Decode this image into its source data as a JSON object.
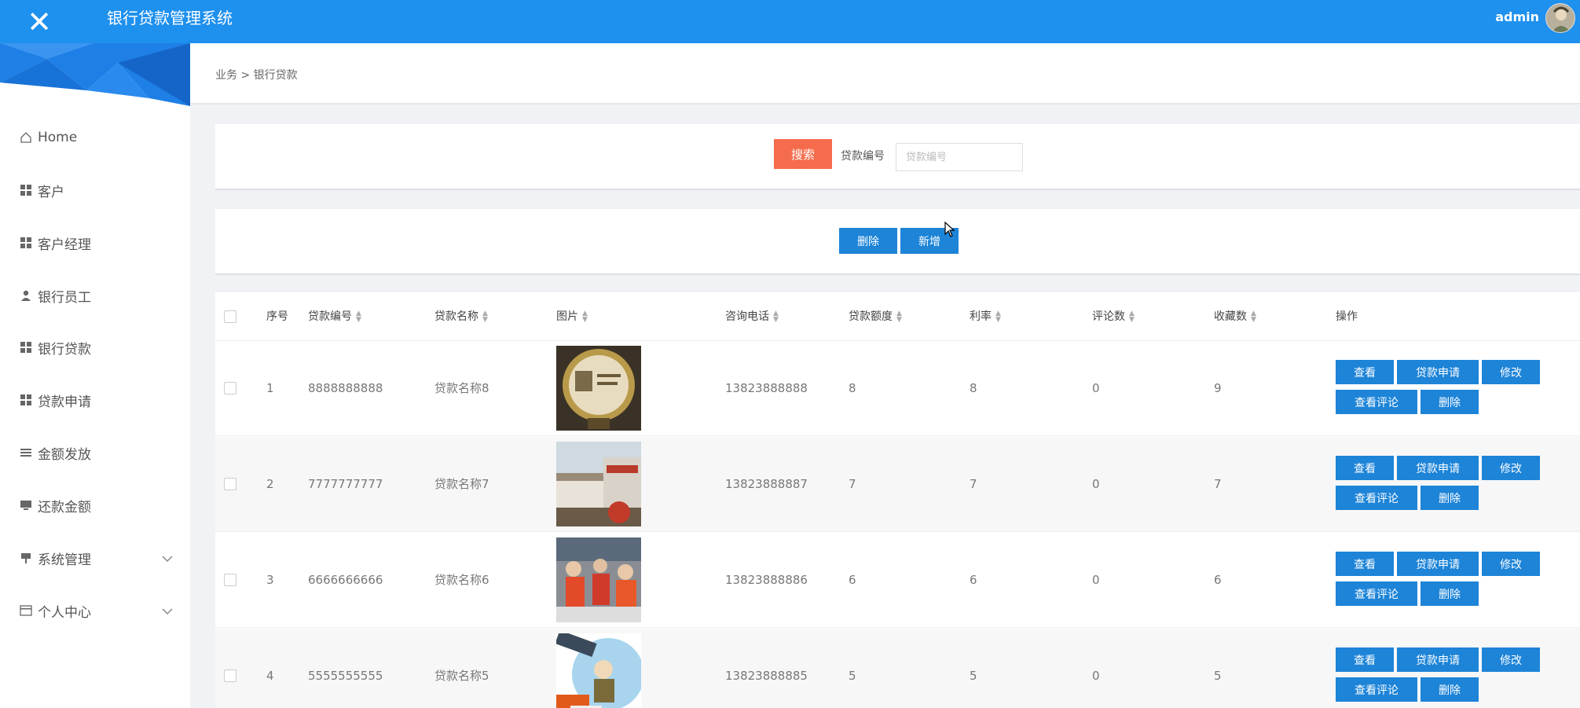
{
  "header": {
    "title": "银行贷款管理系统",
    "user": "admin",
    "colors": {
      "primary": "#1e90ee",
      "danger": "#f56c4c",
      "button": "#1d84d8"
    }
  },
  "sidebar": {
    "items": [
      {
        "label": "Home",
        "icon": "home-icon"
      },
      {
        "label": "客户",
        "icon": "grid-icon"
      },
      {
        "label": "客户经理",
        "icon": "grid-icon"
      },
      {
        "label": "银行员工",
        "icon": "user-icon"
      },
      {
        "label": "银行贷款",
        "icon": "grid-icon"
      },
      {
        "label": "贷款申请",
        "icon": "grid-icon"
      },
      {
        "label": "金额发放",
        "icon": "list-icon"
      },
      {
        "label": "还款金额",
        "icon": "monitor-icon"
      },
      {
        "label": "系统管理",
        "icon": "pin-icon",
        "expandable": true
      },
      {
        "label": "个人中心",
        "icon": "card-icon",
        "expandable": true
      }
    ]
  },
  "breadcrumb": "业务 > 银行贷款",
  "search": {
    "button": "搜索",
    "label": "贷款编号",
    "placeholder": "贷款编号",
    "value": ""
  },
  "actions": {
    "delete": "删除",
    "add": "新增"
  },
  "table": {
    "headers": {
      "index": "序号",
      "code": "贷款编号",
      "name": "贷款名称",
      "image": "图片",
      "phone": "咨询电话",
      "amount": "贷款额度",
      "rate": "利率",
      "comments": "评论数",
      "favorites": "收藏数",
      "ops": "操作"
    },
    "row_buttons": {
      "view": "查看",
      "apply": "贷款申请",
      "edit": "修改",
      "view_comments": "查看评论",
      "delete": "删除"
    },
    "rows": [
      {
        "index": "1",
        "code": "8888888888",
        "name": "贷款名称8",
        "phone": "13823888888",
        "amount": "8",
        "rate": "8",
        "comments": "0",
        "favorites": "9"
      },
      {
        "index": "2",
        "code": "7777777777",
        "name": "贷款名称7",
        "phone": "13823888887",
        "amount": "7",
        "rate": "7",
        "comments": "0",
        "favorites": "7"
      },
      {
        "index": "3",
        "code": "6666666666",
        "name": "贷款名称6",
        "phone": "13823888886",
        "amount": "6",
        "rate": "6",
        "comments": "0",
        "favorites": "6"
      },
      {
        "index": "4",
        "code": "5555555555",
        "name": "贷款名称5",
        "phone": "13823888885",
        "amount": "5",
        "rate": "5",
        "comments": "0",
        "favorites": "5"
      }
    ]
  }
}
